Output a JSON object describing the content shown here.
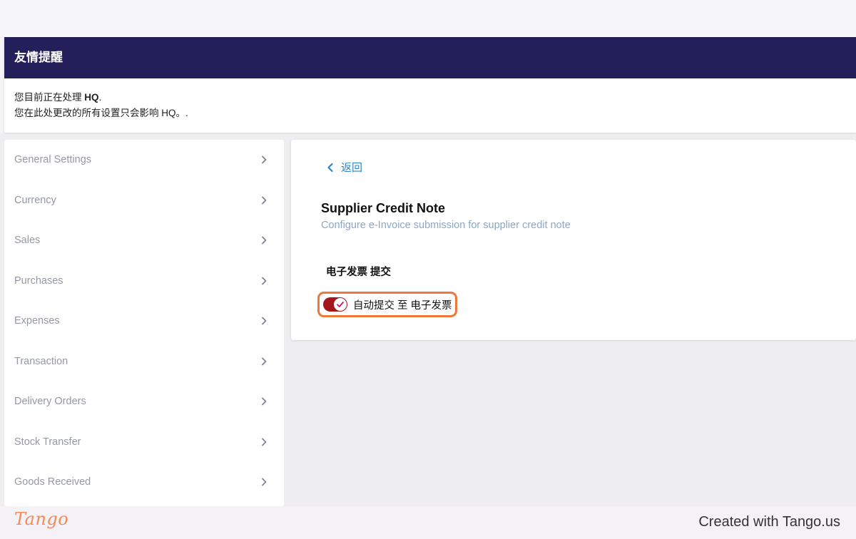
{
  "notice": {
    "title": "友情提醒",
    "line1_prefix": "您目前正在处理 ",
    "line1_entity": "HQ",
    "line1_suffix": ".",
    "line2": "您在此处更改的所有设置只会影响 HQ。."
  },
  "sidebar": {
    "items": [
      {
        "label": "General Settings"
      },
      {
        "label": "Currency"
      },
      {
        "label": "Sales"
      },
      {
        "label": "Purchases"
      },
      {
        "label": "Expenses"
      },
      {
        "label": "Transaction"
      },
      {
        "label": "Delivery Orders"
      },
      {
        "label": "Stock Transfer"
      },
      {
        "label": "Goods Received"
      }
    ]
  },
  "main": {
    "back_label": "返回",
    "title": "Supplier Credit Note",
    "subtitle": "Configure e-Invoice submission for supplier credit note",
    "section_label": "电子发票 提交",
    "toggle": {
      "label": "自动提交 至 电子发票",
      "on": true
    }
  },
  "footer": {
    "logo": "Tango",
    "credit": "Created with Tango.us"
  },
  "colors": {
    "header_bg": "#221f5b",
    "accent_link": "#2f86c9",
    "toggle_on": "#a4161a",
    "highlight": "#f0773a"
  }
}
